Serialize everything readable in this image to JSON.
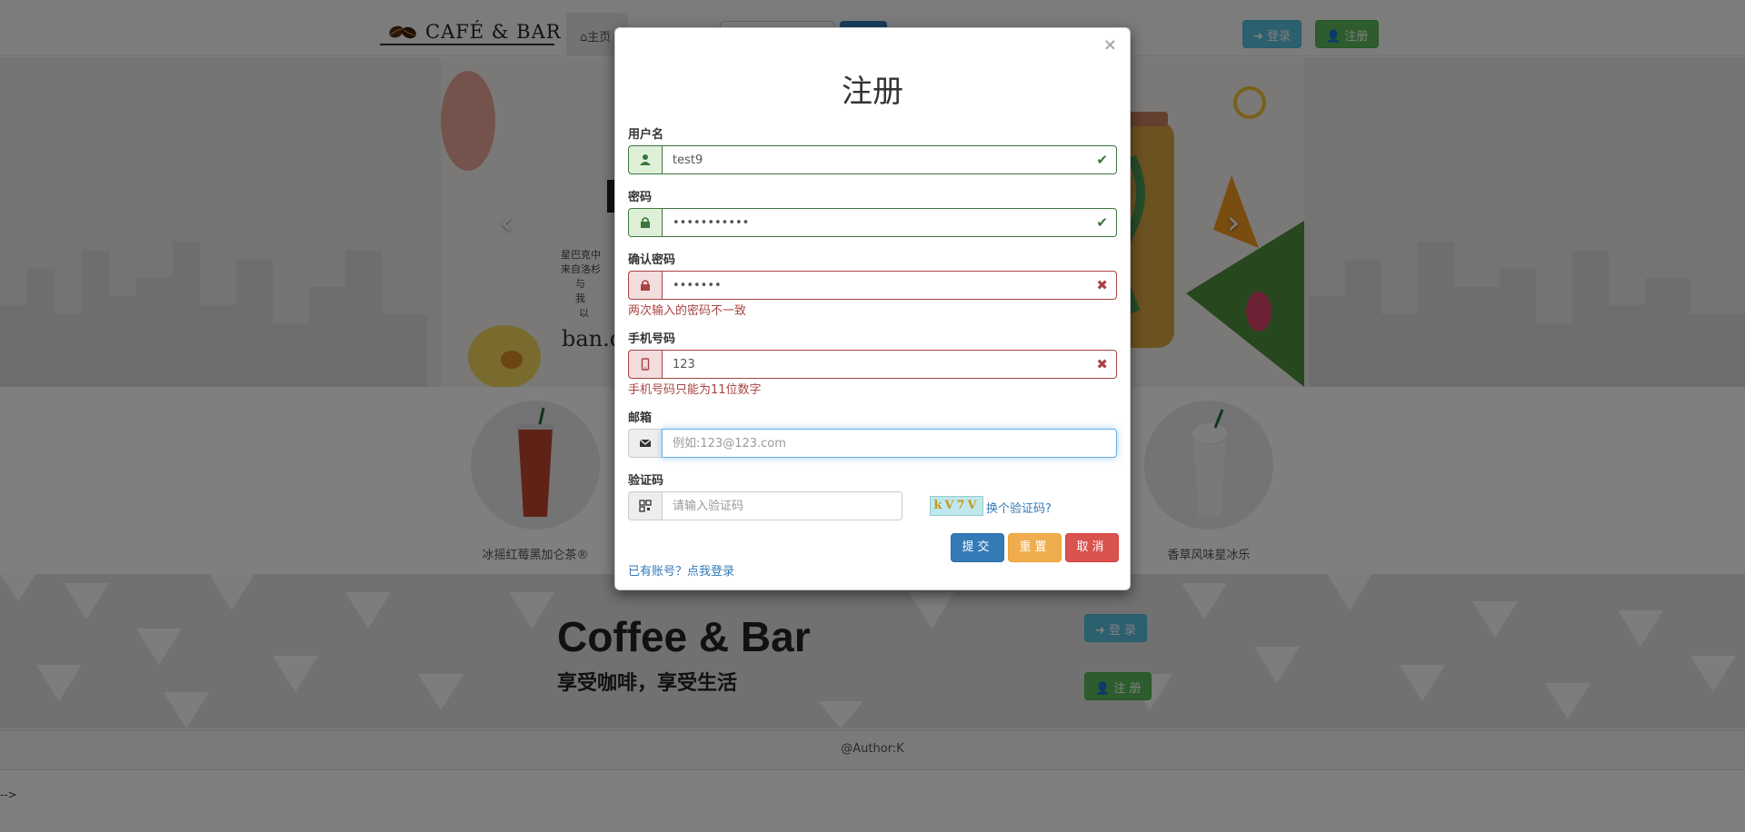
{
  "navbar": {
    "brand": "CAFÉ & BAR",
    "home_label": "主页",
    "login_label": "登录",
    "register_label": "注册"
  },
  "carousel": {
    "lines": [
      "星巴克中",
      "来自洛杉",
      "与",
      "我",
      "以"
    ],
    "signature": "ban.d",
    "prev_glyph": "‹",
    "next_glyph": "›"
  },
  "products": [
    {
      "name": "冰摇红莓黑加仑茶®"
    },
    {
      "name": "香草风味星冰乐"
    }
  ],
  "hero": {
    "title": "Coffee & Bar",
    "subtitle": "享受咖啡，享受生活",
    "login_label": "登 录",
    "register_label": "注 册"
  },
  "footer": {
    "text": "@Author:K"
  },
  "stray_text": "-->",
  "modal": {
    "close": "×",
    "title": "注册",
    "username": {
      "label": "用户名",
      "value": "test9",
      "state": "success"
    },
    "password": {
      "label": "密码",
      "value": "12345678901",
      "state": "success"
    },
    "confirm_password": {
      "label": "确认密码",
      "value": "1234567",
      "state": "error",
      "error": "两次输入的密码不一致"
    },
    "phone": {
      "label": "手机号码",
      "value": "123",
      "state": "error",
      "error": "手机号码只能为11位数字"
    },
    "email": {
      "label": "邮箱",
      "value": "",
      "placeholder": "例如:123@123.com",
      "state": "focus"
    },
    "captcha": {
      "label": "验证码",
      "value": "",
      "placeholder": "请输入验证码",
      "image_text": "kV7V",
      "refresh_label": "换个验证码?"
    },
    "submit_label": "提交",
    "reset_label": "重置",
    "cancel_label": "取消",
    "login_link": "已有账号？点我登录"
  },
  "colors": {
    "primary": "#337ab7",
    "success": "#3c763d",
    "error": "#a94442",
    "warning": "#f0ad4e",
    "danger": "#d9534f",
    "info": "#5bc0de"
  },
  "icons": [
    "coffee-beans-icon",
    "home-icon",
    "login-icon",
    "user-icon",
    "lock-icon",
    "mobile-icon",
    "envelope-icon",
    "qrcode-icon",
    "check-icon",
    "remove-icon"
  ]
}
